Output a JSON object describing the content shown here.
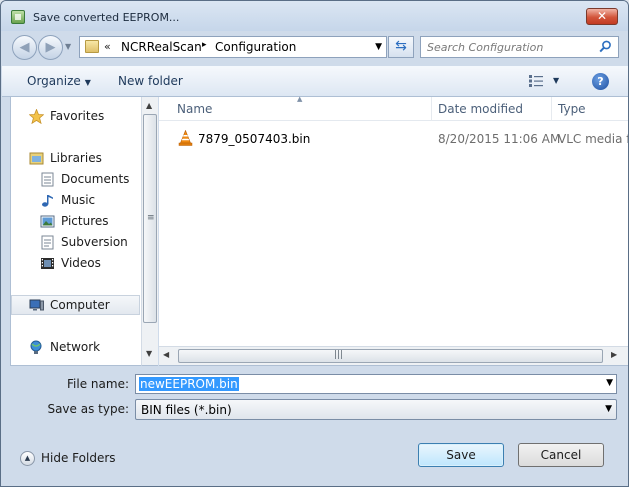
{
  "window": {
    "title": "Save converted EEPROM..."
  },
  "address_bar": {
    "overflow": "«",
    "crumbs": [
      "NCRRealScan",
      "Configuration"
    ],
    "separator": "▸"
  },
  "search": {
    "placeholder": "Search Configuration"
  },
  "toolbar": {
    "organize_label": "Organize",
    "new_folder_label": "New folder",
    "help_label": "?"
  },
  "nav_pane": {
    "favorites": "Favorites",
    "libraries": "Libraries",
    "library_items": [
      "Documents",
      "Music",
      "Pictures",
      "Subversion",
      "Videos"
    ],
    "computer": "Computer",
    "network": "Network",
    "selected": "Computer"
  },
  "file_list": {
    "columns": [
      "Name",
      "Date modified",
      "Type"
    ],
    "rows": [
      {
        "name": "7879_0507403.bin",
        "date_modified": "8/20/2015 11:06 AM",
        "type": "VLC media f"
      }
    ]
  },
  "form": {
    "file_name_label": "File name:",
    "file_name_value": "newEEPROM.bin",
    "save_type_label": "Save as type:",
    "save_type_value": "BIN files (*.bin)"
  },
  "footer": {
    "hide_folders_label": "Hide Folders",
    "save_label": "Save",
    "cancel_label": "Cancel"
  },
  "colors": {
    "title_bar": "#c6d6ea",
    "selection": "#3399ff",
    "close_button": "#c33b22"
  }
}
